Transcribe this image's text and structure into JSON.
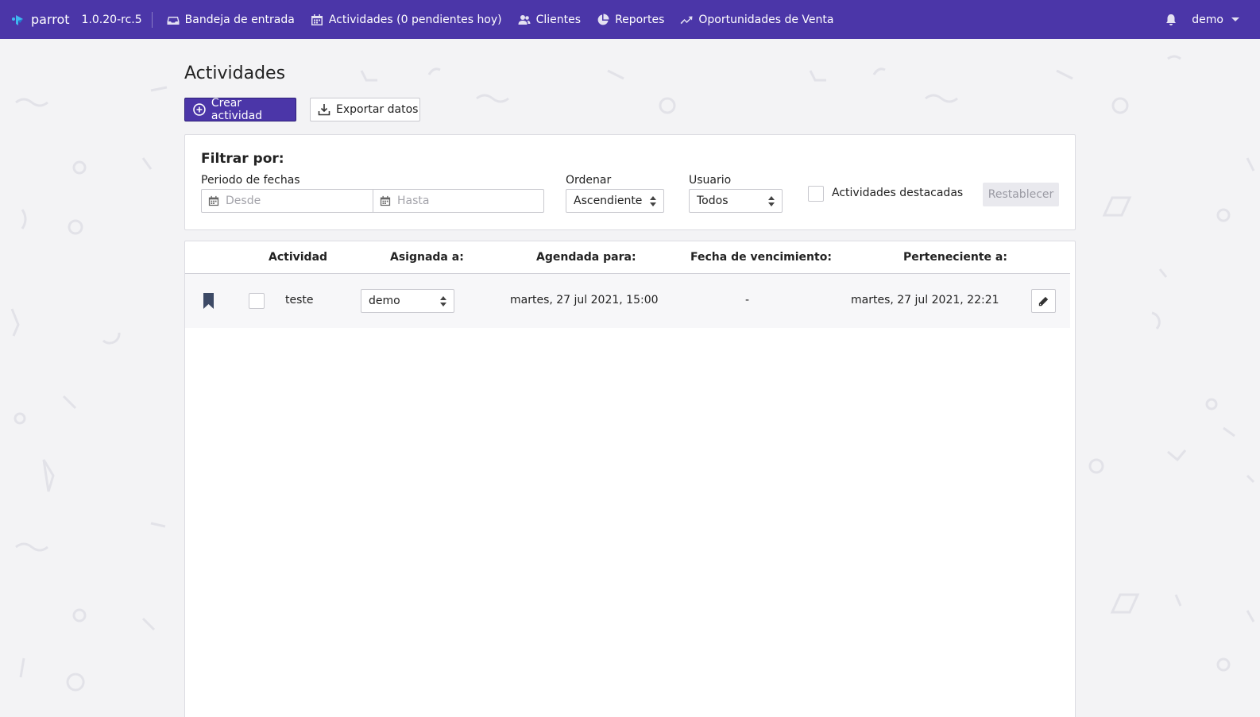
{
  "app": {
    "name": "parrot",
    "version": "1.0.20-rc.5"
  },
  "nav": {
    "items": [
      {
        "label": "Bandeja de entrada",
        "icon": "inbox-icon"
      },
      {
        "label": "Actividades (0 pendientes hoy)",
        "icon": "calendar-icon"
      },
      {
        "label": "Clientes",
        "icon": "users-icon"
      },
      {
        "label": "Reportes",
        "icon": "pie-chart-icon"
      },
      {
        "label": "Oportunidades de Venta",
        "icon": "trend-up-icon"
      }
    ],
    "user": "demo",
    "accent_color": "#4b36a8"
  },
  "page": {
    "title": "Actividades",
    "create_button": "Crear actividad",
    "export_button": "Exportar datos"
  },
  "filters": {
    "title": "Filtrar por:",
    "date_label": "Periodo de fechas",
    "from_placeholder": "Desde",
    "to_placeholder": "Hasta",
    "order_label": "Ordenar",
    "order_value": "Ascendiente",
    "user_label": "Usuario",
    "user_value": "Todos",
    "featured_label": "Actividades destacadas",
    "featured_checked": false,
    "reset_button": "Restablecer"
  },
  "table": {
    "columns": [
      "Actividad",
      "Asignada a:",
      "Agendada para:",
      "Fecha de vencimiento:",
      "Perteneciente a:"
    ],
    "rows": [
      {
        "activity": "teste",
        "assigned_to": "demo",
        "scheduled_for": "martes, 27 jul 2021, 15:00",
        "due_date": "-",
        "belongs_to": "martes, 27 jul 2021, 22:21"
      }
    ]
  }
}
